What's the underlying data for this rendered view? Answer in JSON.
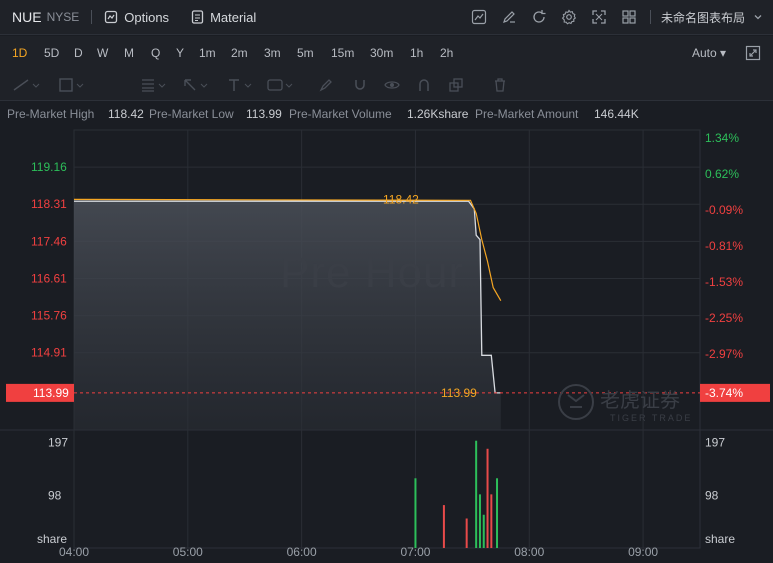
{
  "toolbar": {
    "symbol": "NUE",
    "exchange": "NYSE",
    "options_label": "Options",
    "material_label": "Material",
    "layout_name": "未命名图表布局"
  },
  "periods": [
    "1D",
    "5D",
    "D",
    "W",
    "M",
    "Q",
    "Y",
    "1m",
    "2m",
    "3m",
    "5m",
    "15m",
    "30m",
    "1h",
    "2h"
  ],
  "auto_label": "Auto",
  "info": {
    "high_label": "Pre-Market High",
    "high_value": "118.42",
    "low_label": "Pre-Market Low",
    "low_value": "113.99",
    "volume_label": "Pre-Market Volume",
    "volume_value": "1.26Kshare",
    "amount_label": "Pre-Market Amount",
    "amount_value": "146.44K"
  },
  "watermark": "Pre Hour",
  "logo_text_cn": "老虎证券",
  "logo_text_en": "TIGER TRADE",
  "chart_data": {
    "type": "line",
    "x_ticks": [
      "04:00",
      "05:00",
      "06:00",
      "07:00",
      "08:00",
      "09:00"
    ],
    "price_ticks": [
      "119.16",
      "118.31",
      "117.46",
      "116.61",
      "115.76",
      "114.91"
    ],
    "percent_ticks": [
      "1.34%",
      "0.62%",
      "-0.09%",
      "-0.81%",
      "-1.53%",
      "-2.25%",
      "-2.97%"
    ],
    "current_price": "113.99",
    "current_percent": "-3.74%",
    "high_marker": "118.42",
    "low_marker": "113.99",
    "volume_ticks": [
      "197",
      "98"
    ],
    "volume_unit": "share",
    "price_series": [
      {
        "t": "04:00",
        "v": 118.38
      },
      {
        "t": "07:28",
        "v": 118.38
      },
      {
        "t": "07:31",
        "v": 118.2
      },
      {
        "t": "07:32",
        "v": 117.6
      },
      {
        "t": "07:34",
        "v": 117.5
      },
      {
        "t": "07:35",
        "v": 114.85
      },
      {
        "t": "07:40",
        "v": 114.85
      },
      {
        "t": "07:42",
        "v": 113.99
      },
      {
        "t": "07:45",
        "v": 113.99
      }
    ],
    "avg_series": [
      {
        "t": "04:00",
        "v": 118.42
      },
      {
        "t": "07:29",
        "v": 118.4
      },
      {
        "t": "07:32",
        "v": 118.1
      },
      {
        "t": "07:35",
        "v": 117.5
      },
      {
        "t": "07:38",
        "v": 117.0
      },
      {
        "t": "07:41",
        "v": 116.4
      },
      {
        "t": "07:45",
        "v": 116.1
      }
    ],
    "volume_bars": [
      {
        "t": "07:00",
        "v": 130,
        "dir": "up"
      },
      {
        "t": "07:15",
        "v": 80,
        "dir": "down"
      },
      {
        "t": "07:27",
        "v": 55,
        "dir": "down"
      },
      {
        "t": "07:32",
        "v": 200,
        "dir": "up"
      },
      {
        "t": "07:34",
        "v": 100,
        "dir": "up"
      },
      {
        "t": "07:36",
        "v": 62,
        "dir": "up"
      },
      {
        "t": "07:38",
        "v": 185,
        "dir": "down"
      },
      {
        "t": "07:40",
        "v": 100,
        "dir": "down"
      },
      {
        "t": "07:43",
        "v": 130,
        "dir": "up"
      }
    ],
    "colors": {
      "up": "#2dbf5a",
      "down": "#e84a4a",
      "price_line": "#d8dbe0",
      "avg_line": "#f5a623",
      "current": "#f04040"
    }
  }
}
